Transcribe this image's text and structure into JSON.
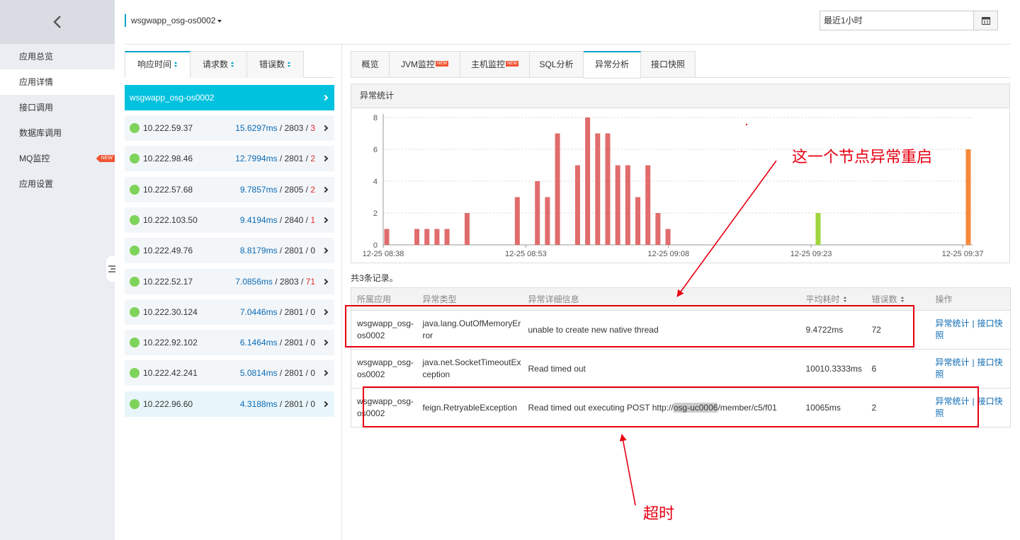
{
  "sidebar": {
    "items": [
      {
        "label": "应用总览",
        "active": false
      },
      {
        "label": "应用详情",
        "active": true
      },
      {
        "label": "接口调用",
        "active": false
      },
      {
        "label": "数据库调用",
        "active": false
      },
      {
        "label": "MQ监控",
        "active": false,
        "badge": "NEW"
      },
      {
        "label": "应用设置",
        "active": false
      }
    ]
  },
  "header": {
    "app_name": "wsgwapp_osg-os0002",
    "time_range": "最近1小时"
  },
  "node_panel": {
    "tabs": [
      "响应时间",
      "请求数",
      "错误数"
    ],
    "app_row": "wsgwapp_osg-os0002",
    "nodes": [
      {
        "ip": "10.222.59.37",
        "rt": "15.6297ms",
        "req": "2803",
        "err": "3",
        "err_red": true
      },
      {
        "ip": "10.222.98.46",
        "rt": "12.7994ms",
        "req": "2801",
        "err": "2",
        "err_red": true
      },
      {
        "ip": "10.222.57.68",
        "rt": "9.7857ms",
        "req": "2805",
        "err": "2",
        "err_red": true
      },
      {
        "ip": "10.222.103.50",
        "rt": "9.4194ms",
        "req": "2840",
        "err": "1",
        "err_red": true
      },
      {
        "ip": "10.222.49.76",
        "rt": "8.8179ms",
        "req": "2801",
        "err": "0",
        "err_red": false
      },
      {
        "ip": "10.222.52.17",
        "rt": "7.0856ms",
        "req": "2803",
        "err": "71",
        "err_red": true
      },
      {
        "ip": "10.222.30.124",
        "rt": "7.0446ms",
        "req": "2801",
        "err": "0",
        "err_red": false
      },
      {
        "ip": "10.222.92.102",
        "rt": "6.1464ms",
        "req": "2801",
        "err": "0",
        "err_red": false
      },
      {
        "ip": "10.222.42.241",
        "rt": "5.0814ms",
        "req": "2801",
        "err": "0",
        "err_red": false
      },
      {
        "ip": "10.222.96.60",
        "rt": "4.3188ms",
        "req": "2801",
        "err": "0",
        "err_red": false
      }
    ]
  },
  "tabs": [
    {
      "label": "概览",
      "new": false,
      "active": false
    },
    {
      "label": "JVM监控",
      "new": true,
      "active": false
    },
    {
      "label": "主机监控",
      "new": true,
      "active": false
    },
    {
      "label": "SQL分析",
      "new": false,
      "active": false
    },
    {
      "label": "异常分析",
      "new": false,
      "active": true
    },
    {
      "label": "接口快照",
      "new": false,
      "active": false
    }
  ],
  "new_badge": "NEW",
  "chart_title": "异常统计",
  "chart_data": {
    "type": "bar",
    "title": "异常统计",
    "x_ticks": [
      "12-25 08:38",
      "12-25 08:53",
      "12-25 09:08",
      "12-25 09:23",
      "12-25 09:37"
    ],
    "ylim": [
      0,
      8
    ],
    "y_ticks": [
      0,
      2,
      4,
      6,
      8
    ],
    "grid": true,
    "legend": "none",
    "bar_units": "minutes after 12-25 08:38",
    "series": [
      {
        "color": "#e06c6c",
        "points": [
          [
            0,
            1
          ],
          [
            3,
            1
          ],
          [
            4,
            1
          ],
          [
            5,
            1
          ],
          [
            6,
            1
          ],
          [
            8,
            2
          ],
          [
            13,
            3
          ],
          [
            15,
            4
          ],
          [
            16,
            3
          ],
          [
            17,
            7
          ],
          [
            19,
            5
          ],
          [
            20,
            8
          ],
          [
            21,
            7
          ],
          [
            22,
            7
          ],
          [
            23,
            5
          ],
          [
            24,
            5
          ],
          [
            25,
            3
          ],
          [
            26,
            5
          ],
          [
            27,
            2
          ],
          [
            28,
            1
          ]
        ]
      },
      {
        "color": "#9fd63f",
        "points": [
          [
            43,
            2
          ]
        ]
      },
      {
        "color": "#f5893a",
        "points": [
          [
            57,
            6
          ]
        ]
      }
    ]
  },
  "record_count": "共3条记录。",
  "table": {
    "headers": [
      "所属应用",
      "异常类型",
      "异常详细信息",
      "平均耗时",
      "错误数",
      "操作"
    ],
    "rows": [
      {
        "app": "wsgwapp_osg-os0002",
        "type": "java.lang.OutOfMemoryError",
        "detail_pre": "unable to create new native thread",
        "detail_hl": "",
        "detail_post": "",
        "avg": "9.4722ms",
        "errors": "72"
      },
      {
        "app": "wsgwapp_osg-os0002",
        "type": "java.net.SocketTimeoutException",
        "detail_pre": "Read timed out",
        "detail_hl": "",
        "detail_post": "",
        "avg": "10010.3333ms",
        "errors": "6"
      },
      {
        "app": "wsgwapp_osg-os0002",
        "type": "feign.RetryableException",
        "detail_pre": "Read timed out executing POST http://",
        "detail_hl": "osg-uc0006",
        "detail_post": "/member/c5/f01",
        "avg": "10065ms",
        "errors": "2"
      }
    ],
    "op_links": [
      "异常统计",
      "接口快照"
    ]
  },
  "annotations": {
    "restart_note": "这一个节点异常重启",
    "timeout_note": "超时",
    "color": "#e60012"
  }
}
